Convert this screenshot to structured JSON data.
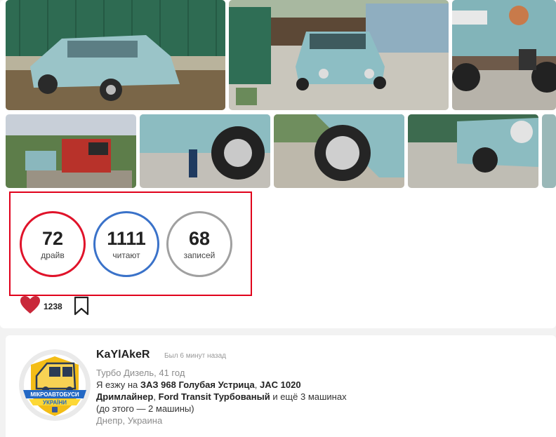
{
  "stats": [
    {
      "value": "72",
      "label": "драйв",
      "color": "#e0132a"
    },
    {
      "value": "1111",
      "label": "читают",
      "color": "#3a72c9"
    },
    {
      "value": "68",
      "label": "записей",
      "color": "#a0a0a0"
    }
  ],
  "likes": {
    "count": "1238",
    "heart_color": "#c9283a"
  },
  "profile": {
    "username": "KaYlAkeR",
    "last_seen": "Был 6 минут назад",
    "subtitle": "Турбо Дизель, 41 год",
    "drives_prefix": "Я езжу на ",
    "car1": "ЗАЗ 968 Голубая Устрица",
    "sep1": ", ",
    "car2": "JAC 1020 Дримлайнер",
    "sep2": ", ",
    "car3": "Ford Transit Турбованый",
    "drives_suffix": " и ещё 3 машинах",
    "previous": "(до этого — 2 машины)",
    "location": "Днепр, Украина",
    "avatar_text_top": "МІКРОАВТОБУСИ",
    "avatar_text_bottom": "УКРАЇНИ"
  },
  "colors": {
    "accent_red": "#e0001b",
    "car_blue": "#7fb2b8"
  }
}
